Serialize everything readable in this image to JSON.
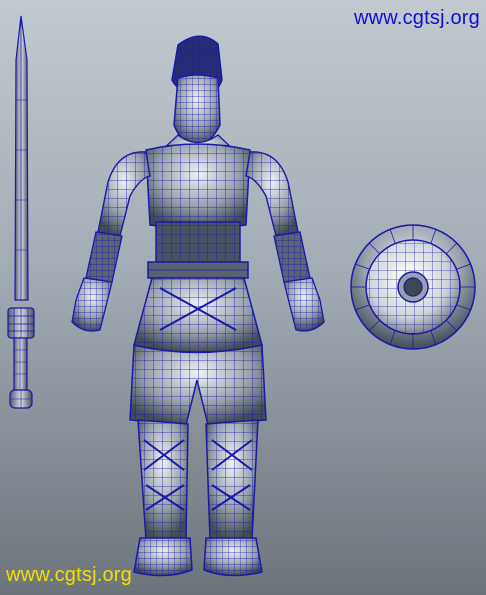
{
  "watermarks": {
    "top": "www.cgtsj.org",
    "bottom": "www.cgtsj.org"
  },
  "colors": {
    "background_top": "#c2c9d0",
    "background_bottom": "#6d747c",
    "wireframe": "#1a1aa8",
    "surface_light": "#e8ecf2",
    "surface_dark": "#3f4654",
    "watermark_top": "#1010d0",
    "watermark_bottom": "#f0e000"
  },
  "scene": {
    "objects": [
      "sword",
      "warrior",
      "shield"
    ]
  }
}
